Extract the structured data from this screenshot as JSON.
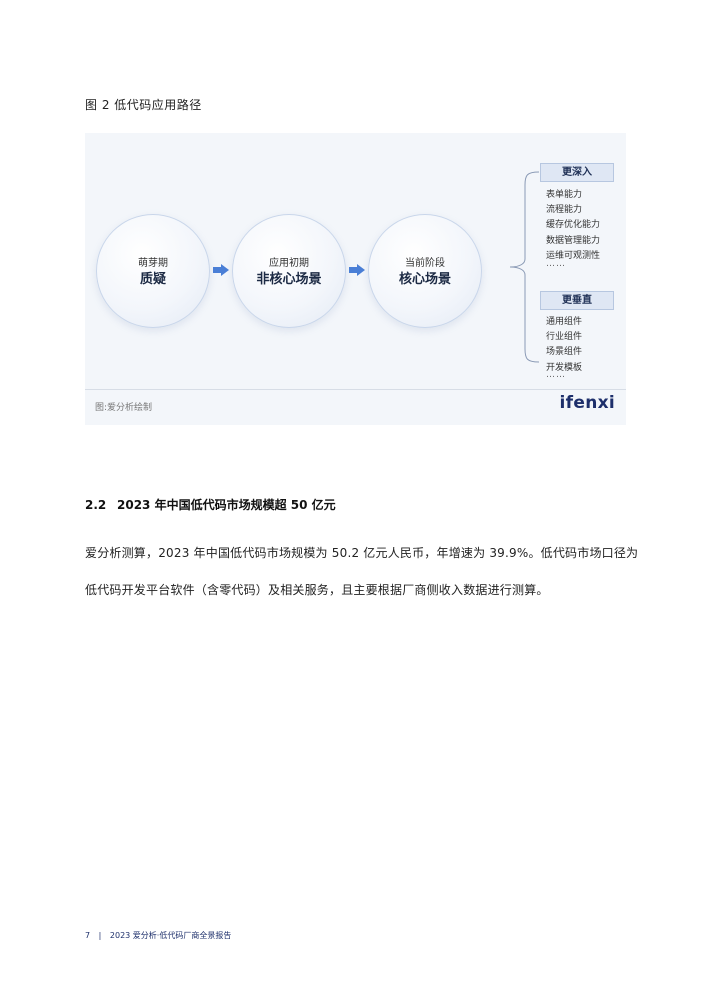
{
  "figure": {
    "caption": "图 2  低代码应用路径",
    "stages": [
      {
        "sub": "萌芽期",
        "main": "质疑"
      },
      {
        "sub": "应用初期",
        "main": "非核心场景"
      },
      {
        "sub": "当前阶段",
        "main": "核心场景"
      }
    ],
    "groups": [
      {
        "label": "更深入",
        "items": [
          "表单能力",
          "流程能力",
          "缓存优化能力",
          "数据管理能力",
          "运维可观测性"
        ],
        "ellipsis": "……"
      },
      {
        "label": "更垂直",
        "items": [
          "通用组件",
          "行业组件",
          "场景组件",
          "开发模板"
        ],
        "ellipsis": "……"
      }
    ],
    "source": "图:爱分析绘制",
    "brand": "ifenxi",
    "colors": {
      "accent": "#4a7fd6",
      "brand": "#1d2f6b",
      "background": "#f3f6fa"
    }
  },
  "section": {
    "number": "2.2",
    "title": "2023 年中国低代码市场规模超 50 亿元"
  },
  "paragraph": {
    "line1": "爱分析测算，2023 年中国低代码市场规模为 50.2 亿元人民币，年增速为 39.9%。低代码市场口径为",
    "line2": "低代码开发平台软件（含零代码）及相关服务，且主要根据厂商侧收入数据进行测算。"
  },
  "footer": {
    "page": "7",
    "separator": "|",
    "title": "2023 爱分析·低代码厂商全景报告"
  }
}
